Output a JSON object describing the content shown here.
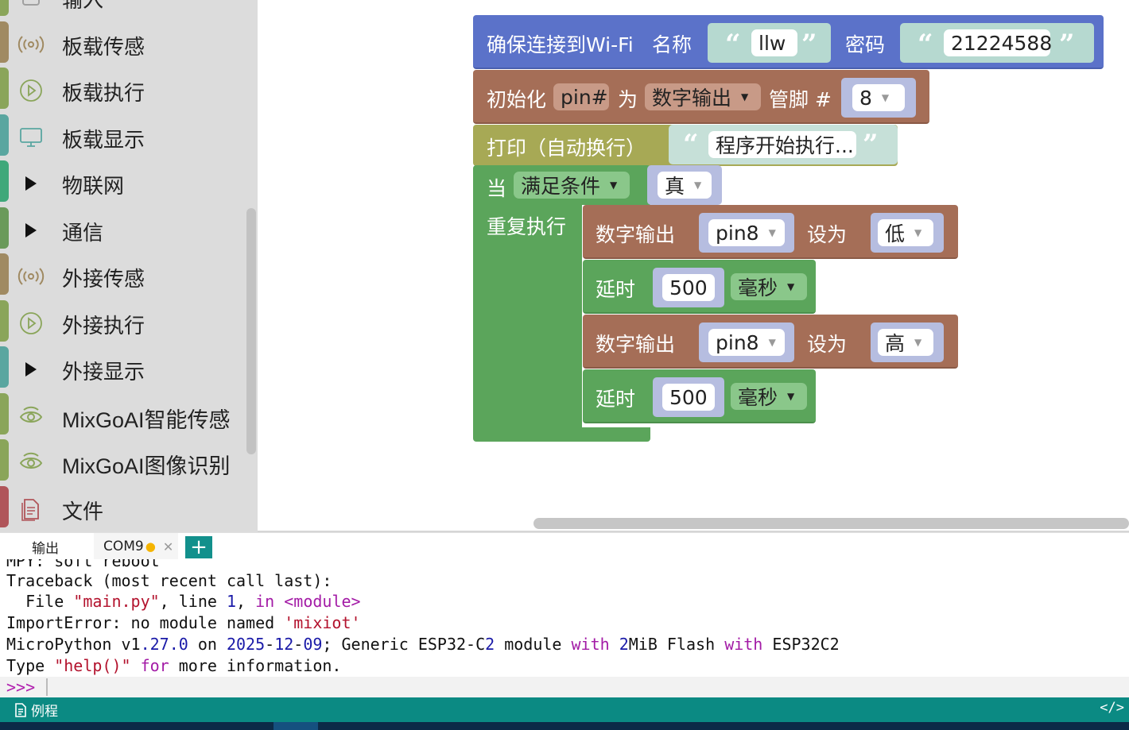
{
  "sidebar": {
    "items": [
      {
        "label": "输入",
        "icon": "input-icon",
        "color": "#8aa55a"
      },
      {
        "label": "板载传感",
        "icon": "sensor-wave-icon",
        "color": "#a08a62"
      },
      {
        "label": "板载执行",
        "icon": "play-circle-icon",
        "color": "#8aa55a"
      },
      {
        "label": "板载显示",
        "icon": "monitor-icon",
        "color": "#5aa6a0"
      },
      {
        "label": "物联网",
        "icon": "expand-triangle-icon",
        "color": "#3fa87a"
      },
      {
        "label": "通信",
        "icon": "expand-triangle-icon",
        "color": "#6a9a5a"
      },
      {
        "label": "外接传感",
        "icon": "sensor-wave-icon",
        "color": "#a08a62"
      },
      {
        "label": "外接执行",
        "icon": "play-circle-icon",
        "color": "#8aa55a"
      },
      {
        "label": "外接显示",
        "icon": "expand-triangle-icon",
        "color": "#5aa6a0"
      },
      {
        "label": "MixGoAI智能传感",
        "icon": "eye-wave-icon",
        "color": "#8aa55a"
      },
      {
        "label": "MixGoAI图像识别",
        "icon": "eye-wave-icon",
        "color": "#8aa55a"
      },
      {
        "label": "文件",
        "icon": "file-icon",
        "color": "#b0555a"
      }
    ]
  },
  "blocks": {
    "wifi": {
      "label": "确保连接到Wi-Fi",
      "name_label": "名称",
      "ssid": "llw",
      "password_label": "密码",
      "password": "21224588",
      "color": "#5b72c9"
    },
    "pin_init": {
      "label": "初始化",
      "var": "pin#",
      "as_label": "为",
      "mode": "数字输出",
      "pin_label": "管脚 #",
      "pin": "8",
      "color": "#a56e57"
    },
    "print": {
      "label": "打印（自动换行）",
      "text": "程序开始执行...",
      "color": "#a7a955"
    },
    "while": {
      "label": "当",
      "condition_mode": "满足条件",
      "condition": "真",
      "repeat_label": "重复执行",
      "color": "#5ba55b"
    },
    "body": [
      {
        "kind": "digital_write",
        "label": "数字输出",
        "pin": "pin8",
        "set_label": "设为",
        "value": "低"
      },
      {
        "kind": "delay",
        "label": "延时",
        "amount": "500",
        "unit": "毫秒"
      },
      {
        "kind": "digital_write",
        "label": "数字输出",
        "pin": "pin8",
        "set_label": "设为",
        "value": "高"
      },
      {
        "kind": "delay",
        "label": "延时",
        "amount": "500",
        "unit": "毫秒"
      }
    ]
  },
  "tabs": {
    "output": "输出",
    "com": "COM9",
    "add": "+"
  },
  "console": {
    "lines": [
      "MPY: soft reboot",
      "Traceback (most recent call last):",
      "  File \"main.py\", line 1, in <module>",
      "ImportError: no module named 'mixiot'",
      "MicroPython v1.27.0 on 2025-12-09; Generic ESP32-C2 module with 2MiB Flash with ESP32C2",
      "Type \"help()\" for more information."
    ],
    "prompt": ">>>"
  },
  "status": {
    "examples_label": "例程",
    "code_toggle": "</>"
  }
}
